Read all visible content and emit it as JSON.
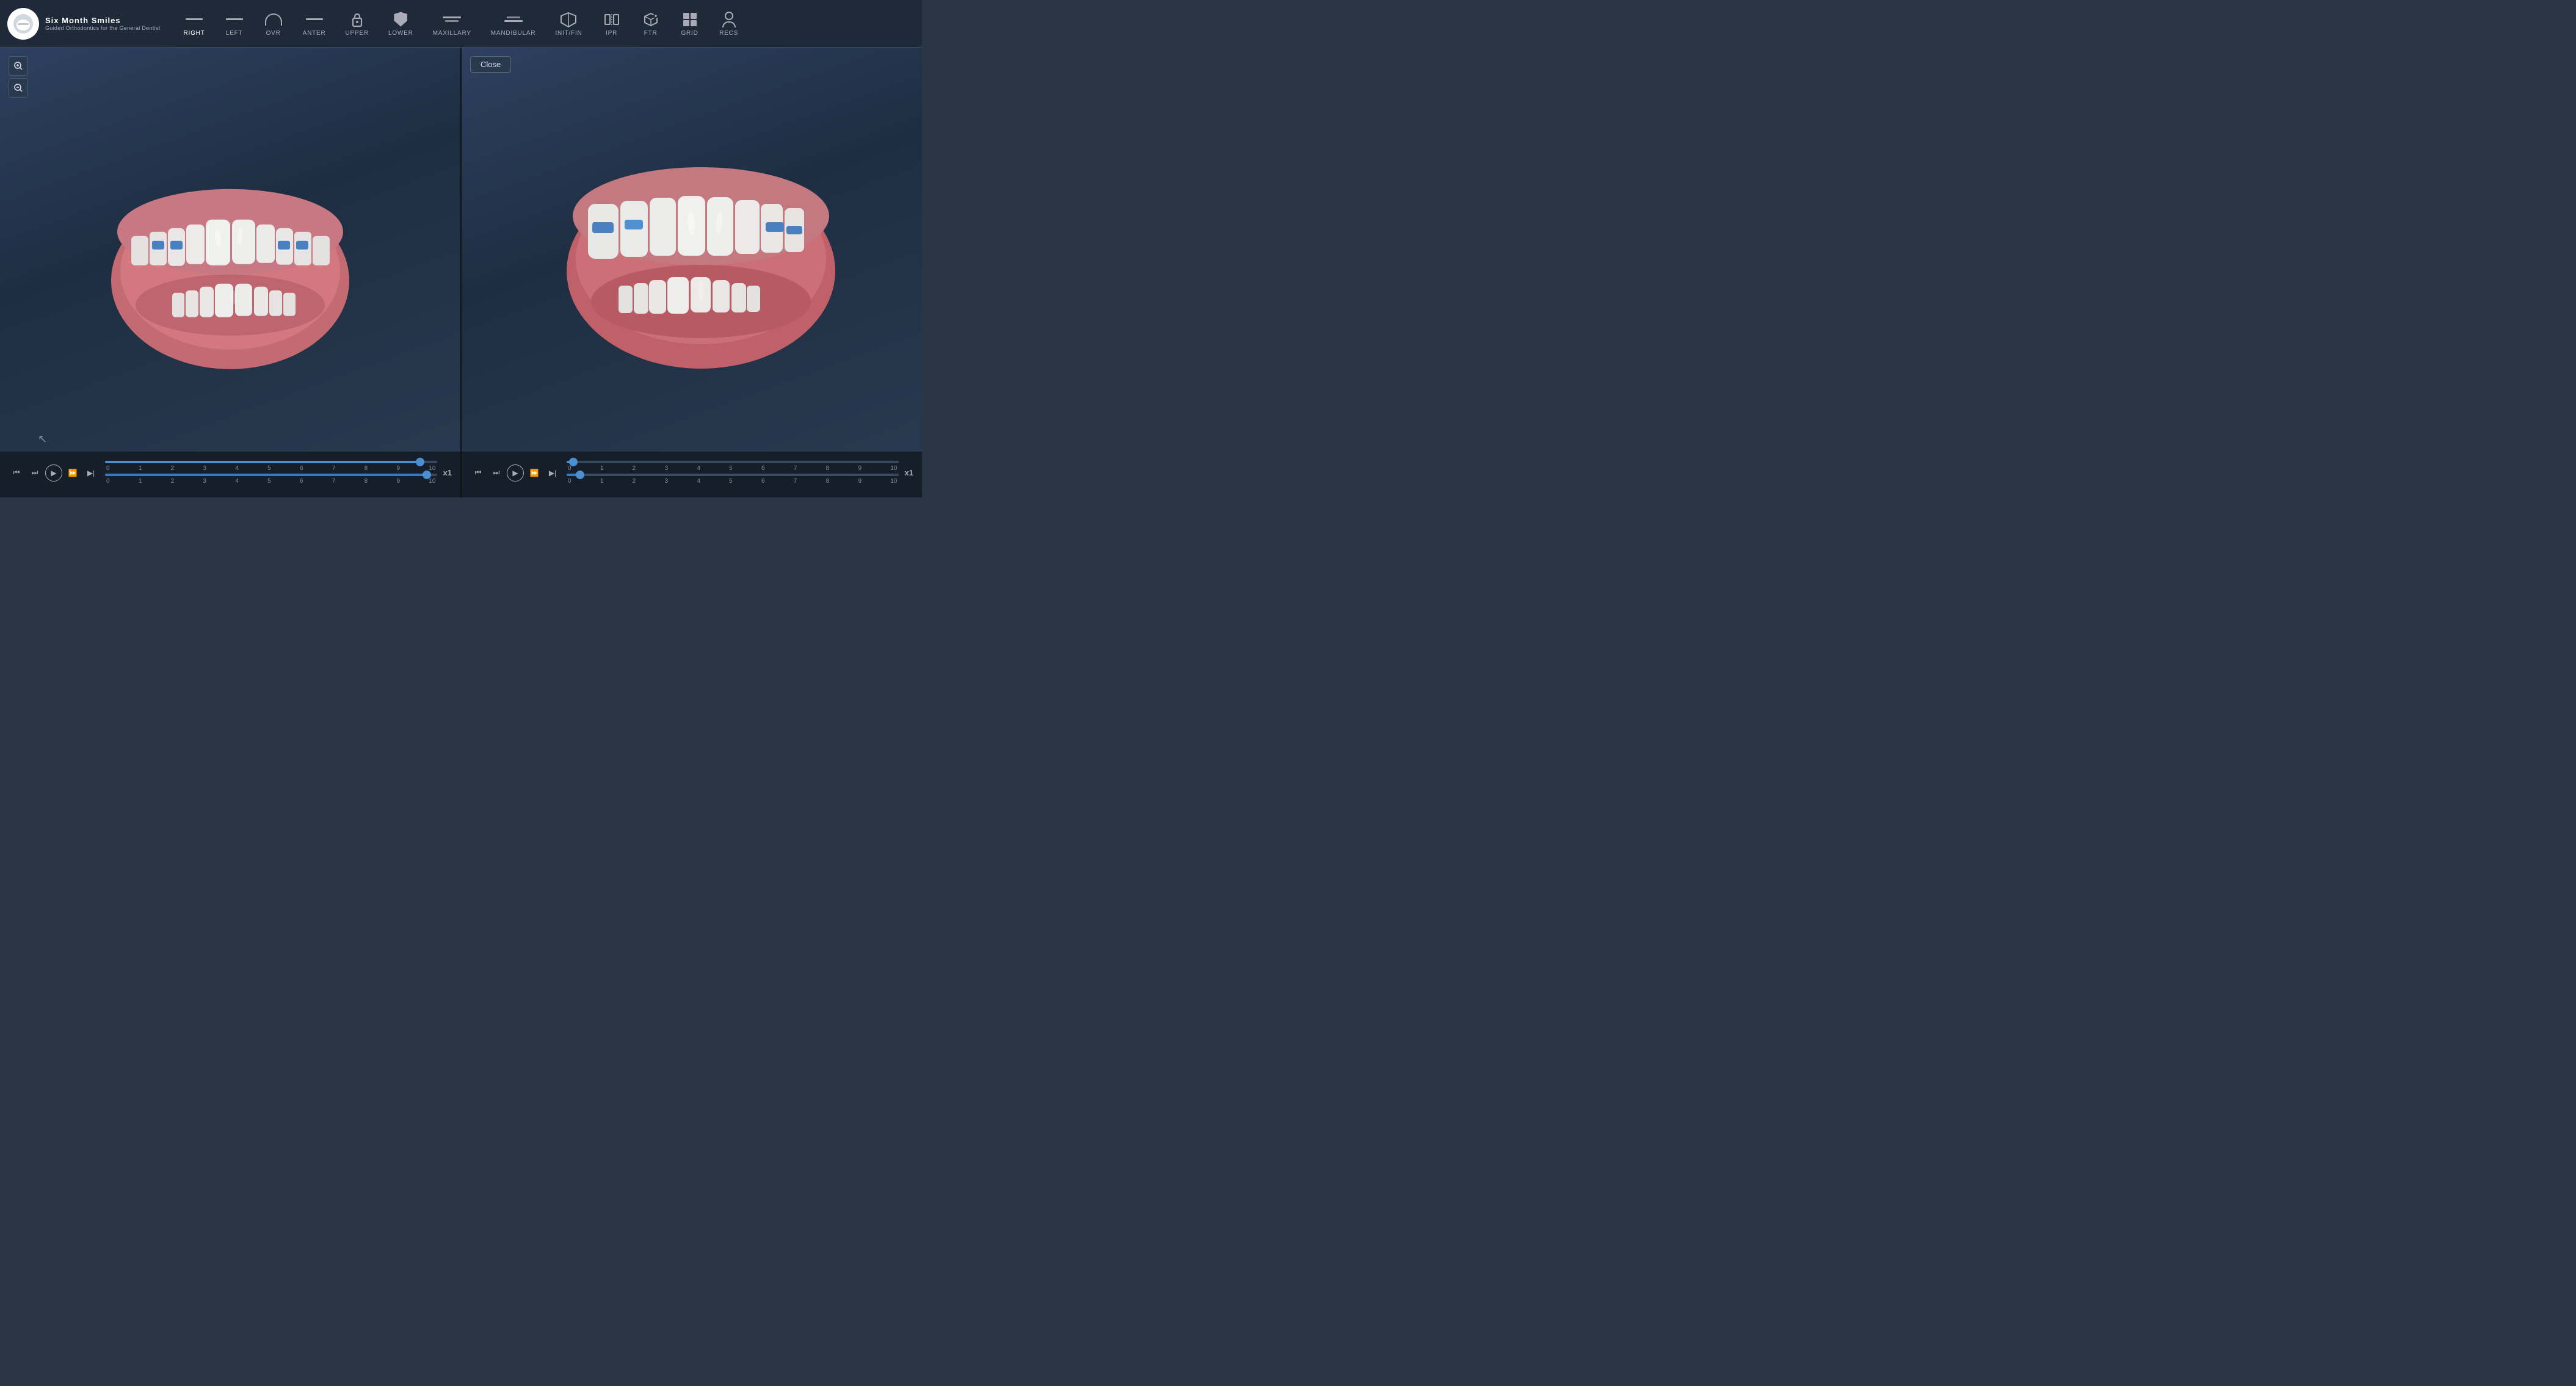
{
  "app": {
    "title": "Six Month Smiles",
    "subtitle": "Guided Orthodontics for the General Dentist"
  },
  "nav": {
    "items": [
      {
        "id": "right",
        "label": "RIGHT",
        "icon": "bar-icon",
        "active": true
      },
      {
        "id": "left",
        "label": "LEFT",
        "icon": "bar-icon"
      },
      {
        "id": "ovr",
        "label": "OVR",
        "icon": "arch-icon"
      },
      {
        "id": "anter",
        "label": "ANTER",
        "icon": "bar-icon"
      },
      {
        "id": "upper",
        "label": "UPPER",
        "icon": "lock-icon"
      },
      {
        "id": "lower",
        "label": "LOWER",
        "icon": "shield-icon"
      },
      {
        "id": "maxillary",
        "label": "MAXILLARY",
        "icon": "bar-icon"
      },
      {
        "id": "mandibular",
        "label": "MANDIBULAR",
        "icon": "bar-icon"
      },
      {
        "id": "initfin",
        "label": "INIT/FIN",
        "icon": "shield-icon"
      },
      {
        "id": "ipr",
        "label": "IPR",
        "icon": "ipr-icon"
      },
      {
        "id": "ftr",
        "label": "FTR",
        "icon": "ftr-icon"
      },
      {
        "id": "grid",
        "label": "GRID",
        "icon": "grid-icon"
      },
      {
        "id": "recs",
        "label": "RECS",
        "icon": "person-icon"
      }
    ]
  },
  "left_panel": {
    "zoom_in_label": "+",
    "zoom_out_label": "−"
  },
  "right_panel": {
    "close_button_label": "Close"
  },
  "playback": {
    "speed_label": "x1",
    "slider_min": "0",
    "slider_max": "10",
    "tick_labels": [
      "0",
      "1",
      "2",
      "3",
      "4",
      "5",
      "6",
      "7",
      "8",
      "9",
      "10"
    ],
    "left_fill_percent": 95,
    "left_thumb_percent": 95,
    "left_second_fill_percent": 97,
    "left_second_thumb_percent": 97,
    "right_fill_percent": 2,
    "right_thumb_percent": 2,
    "right_second_fill_percent": 4,
    "right_second_thumb_percent": 4
  }
}
